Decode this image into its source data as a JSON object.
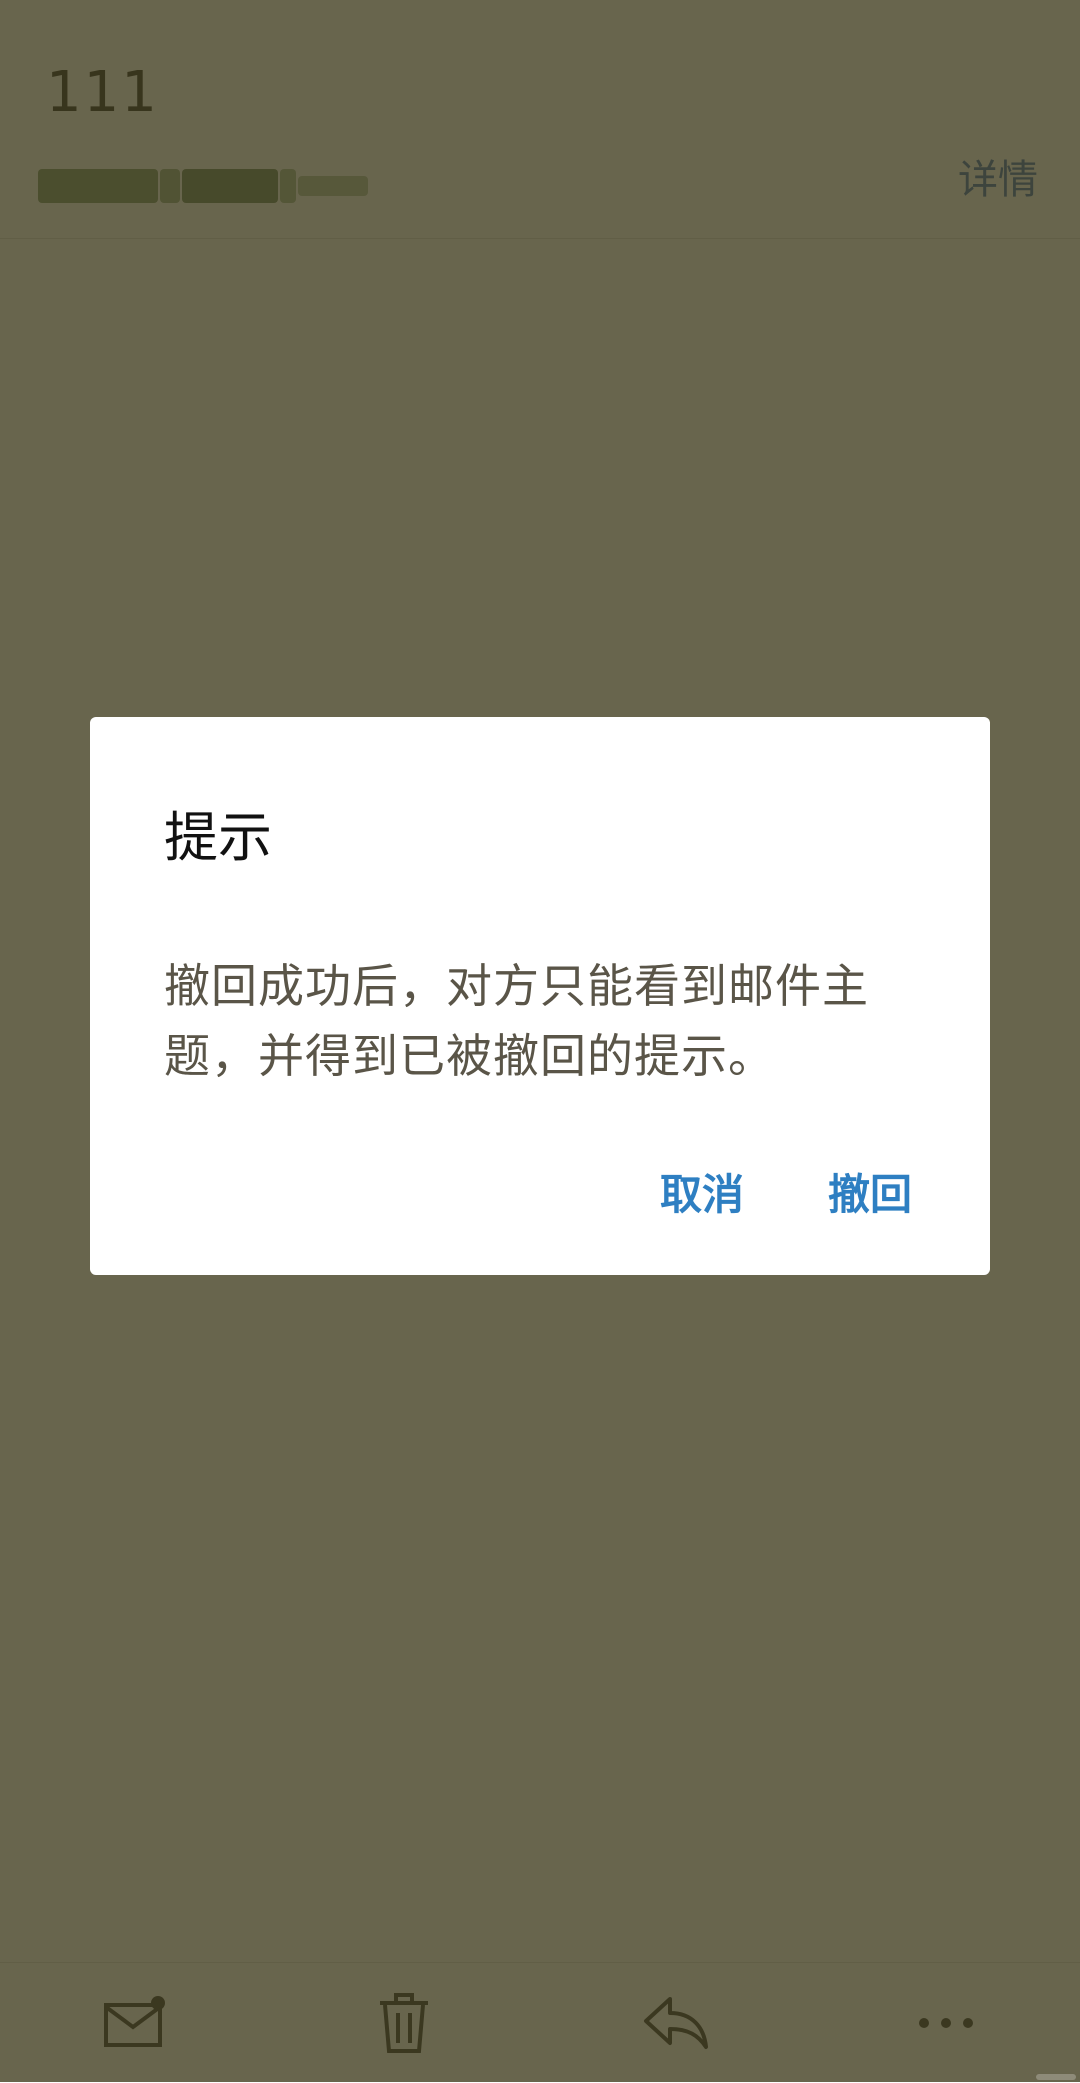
{
  "email": {
    "subject": "111",
    "details_link": "详情"
  },
  "dialog": {
    "title": "提示",
    "message": "撤回成功后，对方只能看到邮件主题，并得到已被撤回的提示。",
    "cancel_label": "取消",
    "confirm_label": "撤回"
  },
  "toolbar": {
    "items": [
      {
        "icon": "mail-icon"
      },
      {
        "icon": "trash-icon"
      },
      {
        "icon": "reply-icon"
      },
      {
        "icon": "more-icon"
      }
    ]
  },
  "colors": {
    "overlay": "#66634f",
    "accent": "#2e7fc2",
    "dialog_text": "#5a5548",
    "link": "#2a5db0"
  }
}
